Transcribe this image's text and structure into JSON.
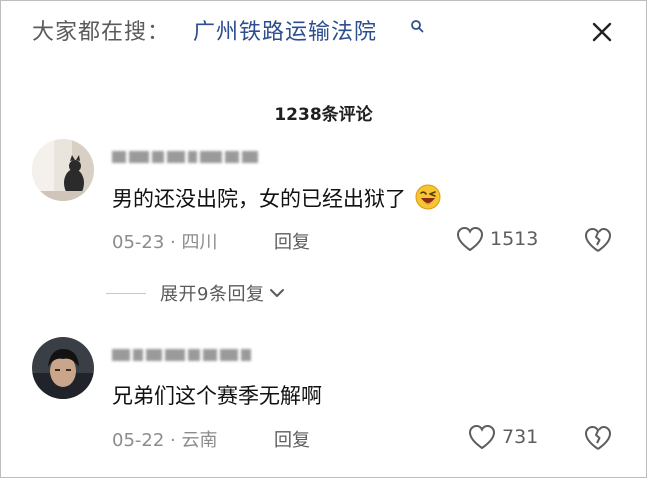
{
  "search_bar": {
    "prefix": "大家都在搜：",
    "term": "广州铁路运输法院"
  },
  "comment_count": "1238条评论",
  "comments": [
    {
      "text": "男的还没出院，女的已经出狱了",
      "emoji": "laughing-wink-emoji",
      "date": "05-23",
      "location": "四川",
      "reply_label": "回复",
      "likes": "1513",
      "expand_label": "展开9条回复"
    },
    {
      "text": "兄弟们这个赛季无解啊",
      "date": "05-22",
      "location": "云南",
      "reply_label": "回复",
      "likes": "731"
    }
  ],
  "colors": {
    "link_blue": "#2d4f8f",
    "meta_gray": "#8c8c8c",
    "text_dark": "#111111"
  }
}
